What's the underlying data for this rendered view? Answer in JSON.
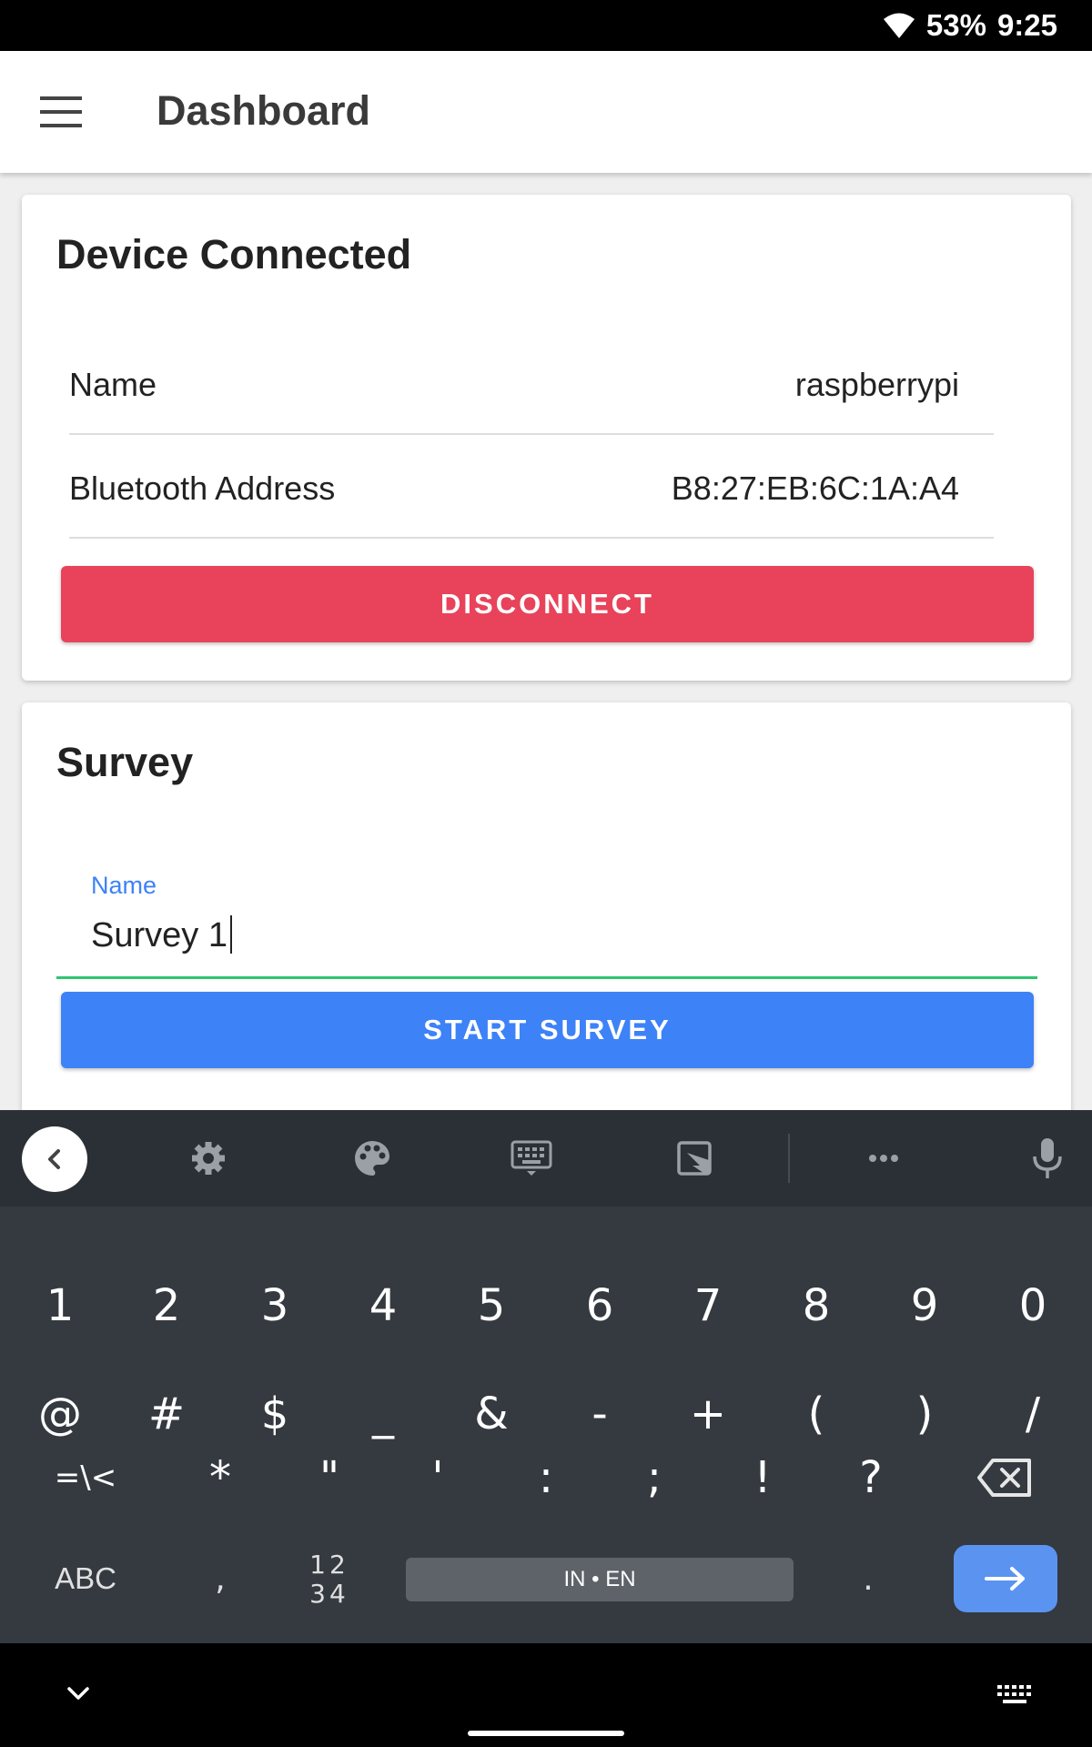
{
  "status_bar": {
    "battery": "53%",
    "time": "9:25"
  },
  "app_bar": {
    "title": "Dashboard"
  },
  "device_card": {
    "title": "Device Connected",
    "rows": [
      {
        "label": "Name",
        "value": "raspberrypi"
      },
      {
        "label": "Bluetooth Address",
        "value": "B8:27:EB:6C:1A:A4"
      }
    ],
    "disconnect_label": "DISCONNECT",
    "disconnect_color": "#e8435a"
  },
  "survey_card": {
    "title": "Survey",
    "name_label": "Name",
    "name_value": "Survey 1",
    "start_label": "START SURVEY",
    "start_color": "#3d82f7",
    "underline_color": "#2ec66f"
  },
  "keyboard": {
    "row1": [
      "1",
      "2",
      "3",
      "4",
      "5",
      "6",
      "7",
      "8",
      "9",
      "0"
    ],
    "row2": [
      "@",
      "#",
      "$",
      "_",
      "&",
      "-",
      "+",
      "(",
      ")",
      "/"
    ],
    "row3": [
      "=\\<",
      "*",
      "\"",
      "'",
      ":",
      ";",
      "!",
      "?"
    ],
    "abc_label": "ABC",
    "comma": ",",
    "num_toggle_top": "12",
    "num_toggle_bottom": "34",
    "space_label": "IN • EN",
    "period": ".",
    "toolbar_icons": [
      "back-icon",
      "settings-icon",
      "palette-icon",
      "keyboard-icon",
      "screenshot-icon",
      "more-icon",
      "microphone-icon"
    ]
  }
}
